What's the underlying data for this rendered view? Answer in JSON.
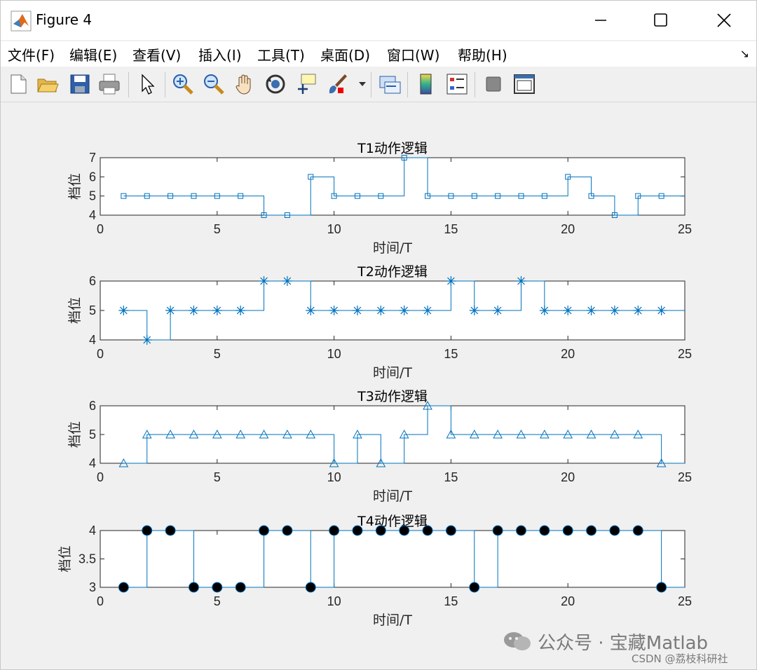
{
  "window": {
    "title": "Figure 4"
  },
  "menu": [
    {
      "label": "文件(F)"
    },
    {
      "label": "编辑(E)"
    },
    {
      "label": "查看(V)"
    },
    {
      "label": "插入(I)"
    },
    {
      "label": "工具(T)"
    },
    {
      "label": "桌面(D)"
    },
    {
      "label": "窗口(W)"
    },
    {
      "label": "帮助(H)"
    }
  ],
  "toolbar": [
    "new-figure-icon",
    "open-icon",
    "save-icon",
    "print-icon",
    "pointer-icon",
    "zoom-in-icon",
    "zoom-out-icon",
    "pan-hand-icon",
    "rotate-3d-icon",
    "data-cursor-icon",
    "brush-icon",
    "link-icon",
    "colorbar-icon",
    "legend-icon",
    "hide-plot-tools-icon",
    "show-plot-tools-icon"
  ],
  "watermark": {
    "text": "公众号 · 宝藏Matlab",
    "sub": "CSDN @荔枝科研社"
  },
  "colors": {
    "line": "#0072BD",
    "marker_fill_t4": "#000000"
  },
  "chart_data": [
    {
      "type": "line",
      "title": "T1动作逻辑",
      "xlabel": "时间/T",
      "ylabel": "档位",
      "xlim": [
        0,
        25
      ],
      "ylim": [
        4,
        7
      ],
      "xticks": [
        0,
        5,
        10,
        15,
        20,
        25
      ],
      "yticks": [
        4,
        5,
        6,
        7
      ],
      "marker": "square",
      "step": true,
      "grid": false,
      "x": [
        1,
        2,
        3,
        4,
        5,
        6,
        7,
        8,
        9,
        10,
        11,
        12,
        13,
        14,
        15,
        16,
        17,
        18,
        19,
        20,
        21,
        22,
        23,
        24
      ],
      "y": [
        5,
        5,
        5,
        5,
        5,
        5,
        4,
        4,
        6,
        5,
        5,
        5,
        7,
        5,
        5,
        5,
        5,
        5,
        5,
        6,
        5,
        4,
        5,
        5
      ]
    },
    {
      "type": "line",
      "title": "T2动作逻辑",
      "xlabel": "时间/T",
      "ylabel": "档位",
      "xlim": [
        0,
        25
      ],
      "ylim": [
        4,
        6
      ],
      "xticks": [
        0,
        5,
        10,
        15,
        20,
        25
      ],
      "yticks": [
        4,
        5,
        6
      ],
      "marker": "asterisk",
      "step": true,
      "grid": false,
      "x": [
        1,
        2,
        3,
        4,
        5,
        6,
        7,
        8,
        9,
        10,
        11,
        12,
        13,
        14,
        15,
        16,
        17,
        18,
        19,
        20,
        21,
        22,
        23,
        24
      ],
      "y": [
        5,
        4,
        5,
        5,
        5,
        5,
        6,
        6,
        5,
        5,
        5,
        5,
        5,
        5,
        6,
        5,
        5,
        6,
        5,
        5,
        5,
        5,
        5,
        5
      ]
    },
    {
      "type": "line",
      "title": "T3动作逻辑",
      "xlabel": "时间/T",
      "ylabel": "档位",
      "xlim": [
        0,
        25
      ],
      "ylim": [
        4,
        6
      ],
      "xticks": [
        0,
        5,
        10,
        15,
        20,
        25
      ],
      "yticks": [
        4,
        5,
        6
      ],
      "marker": "triangle",
      "step": true,
      "grid": false,
      "x": [
        1,
        2,
        3,
        4,
        5,
        6,
        7,
        8,
        9,
        10,
        11,
        12,
        13,
        14,
        15,
        16,
        17,
        18,
        19,
        20,
        21,
        22,
        23,
        24
      ],
      "y": [
        4,
        5,
        5,
        5,
        5,
        5,
        5,
        5,
        5,
        4,
        5,
        4,
        5,
        6,
        5,
        5,
        5,
        5,
        5,
        5,
        5,
        5,
        5,
        4
      ]
    },
    {
      "type": "line",
      "title": "T4动作逻辑",
      "xlabel": "时间/T",
      "ylabel": "档位",
      "xlim": [
        0,
        25
      ],
      "ylim": [
        3,
        4
      ],
      "xticks": [
        0,
        5,
        10,
        15,
        20,
        25
      ],
      "yticks": [
        3,
        3.5,
        4
      ],
      "marker": "filled-circle",
      "step": true,
      "grid": false,
      "x": [
        1,
        2,
        3,
        4,
        5,
        6,
        7,
        8,
        9,
        10,
        11,
        12,
        13,
        14,
        15,
        16,
        17,
        18,
        19,
        20,
        21,
        22,
        23,
        24
      ],
      "y": [
        3,
        4,
        4,
        3,
        3,
        3,
        4,
        4,
        3,
        4,
        4,
        4,
        4,
        4,
        4,
        3,
        4,
        4,
        4,
        4,
        4,
        4,
        4,
        3
      ]
    }
  ]
}
